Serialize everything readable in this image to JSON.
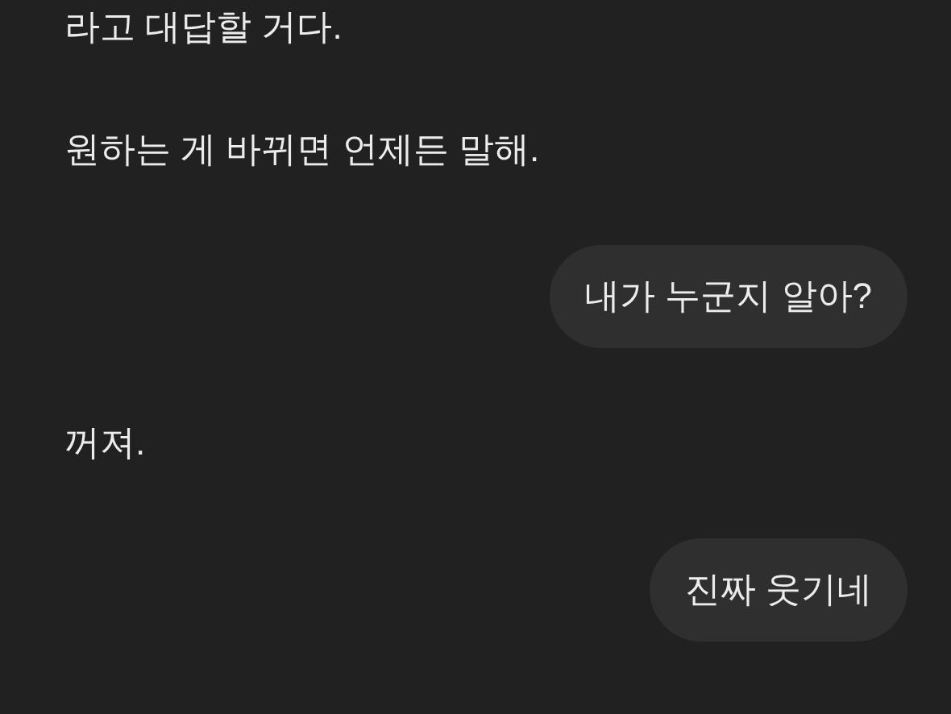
{
  "messages": [
    {
      "kind": "reply",
      "text": "라고 대답할 거다."
    },
    {
      "kind": "reply",
      "text": "원하는 게 바뀌면 언제든 말해."
    },
    {
      "kind": "bubble",
      "text": "내가 누군지 알아?"
    },
    {
      "kind": "reply",
      "text": "꺼져."
    },
    {
      "kind": "bubble",
      "text": "진짜 웃기네"
    }
  ]
}
